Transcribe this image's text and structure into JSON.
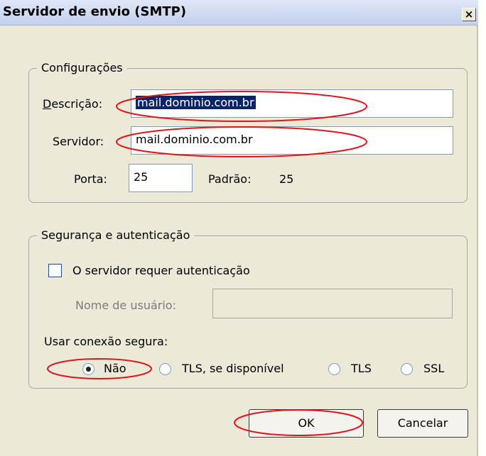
{
  "dialog": {
    "title": "Servidor de envio (SMTP)",
    "close_glyph": "×"
  },
  "config": {
    "legend": "Configurações",
    "descricao_label": "Descrição:",
    "descricao_value": "mail.dominio.com.br",
    "servidor_label": "Servidor:",
    "servidor_value": "mail.dominio.com.br",
    "porta_label": "Porta:",
    "porta_value": "25",
    "padrao_label": "Padrão:",
    "padrao_value": "25"
  },
  "security": {
    "legend": "Segurança e autenticação",
    "auth_checkbox_label": "O servidor requer autenticação",
    "auth_checked": false,
    "username_label": "Nome de usuário:",
    "username_value": "",
    "secure_label": "Usar conexão segura:",
    "options": {
      "nao": "Não",
      "tls_available": "TLS, se disponível",
      "tls": "TLS",
      "ssl": "SSL"
    },
    "selected": "Não"
  },
  "buttons": {
    "ok": "OK",
    "cancel": "Cancelar"
  },
  "colors": {
    "highlight_ellipse": "#e0161c",
    "selection": "#0a246a",
    "dialog_bg": "#ece9d8"
  }
}
